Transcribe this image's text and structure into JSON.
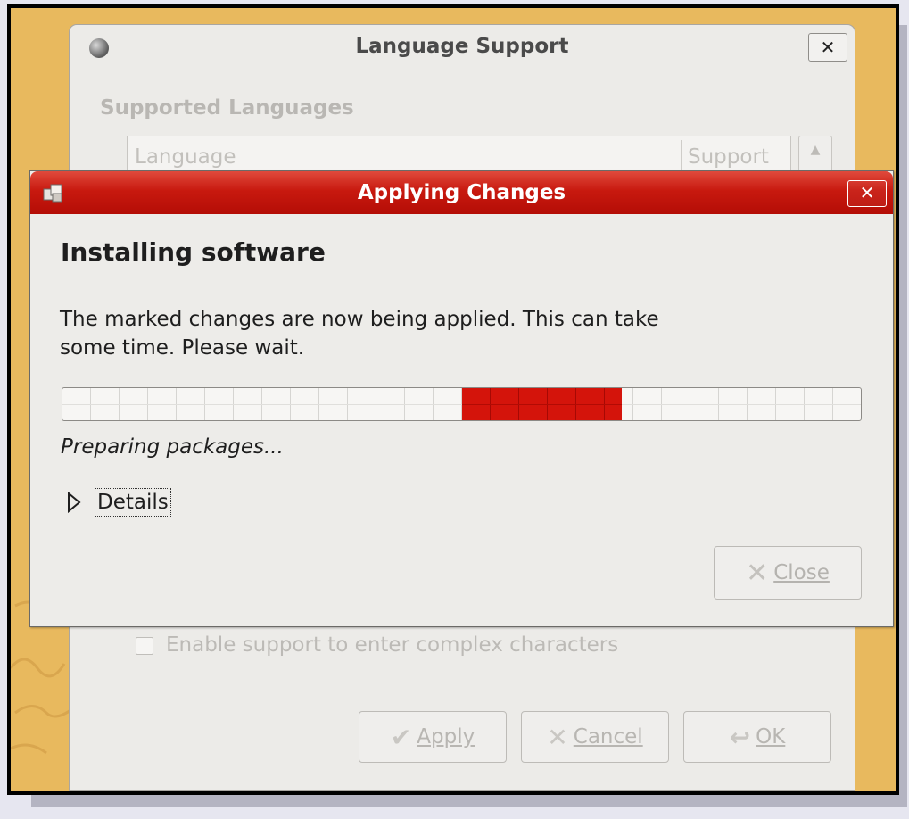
{
  "background_window": {
    "title": "Language Support",
    "close_glyph": "✕",
    "section_heading": "Supported Languages",
    "table": {
      "columns": [
        "Language",
        "Support"
      ]
    },
    "checkbox": {
      "label": "Enable support to enter complex characters",
      "checked": false
    },
    "buttons": {
      "apply": {
        "label": "Apply",
        "icon": "check-icon",
        "glyph": "✔"
      },
      "cancel": {
        "label": "Cancel",
        "icon": "cancel-icon",
        "glyph": "✕"
      },
      "ok": {
        "label": "OK",
        "icon": "ok-icon",
        "glyph": "↩"
      }
    }
  },
  "dialog": {
    "title": "Applying Changes",
    "close_glyph": "✕",
    "heading": "Installing software",
    "message": "The marked changes are now being applied. This can take some time. Please wait.",
    "progress": {
      "mode": "pulse",
      "pulse_start": 0.5,
      "pulse_end": 0.7,
      "color": "#d4140b"
    },
    "status": "Preparing packages...",
    "details_label": "Details",
    "close_button": {
      "label": "Close",
      "icon": "close-icon",
      "glyph": "✕",
      "enabled": false
    }
  },
  "colors": {
    "titlebar_red": "#c8190f",
    "desktop": "#e8b95e"
  }
}
